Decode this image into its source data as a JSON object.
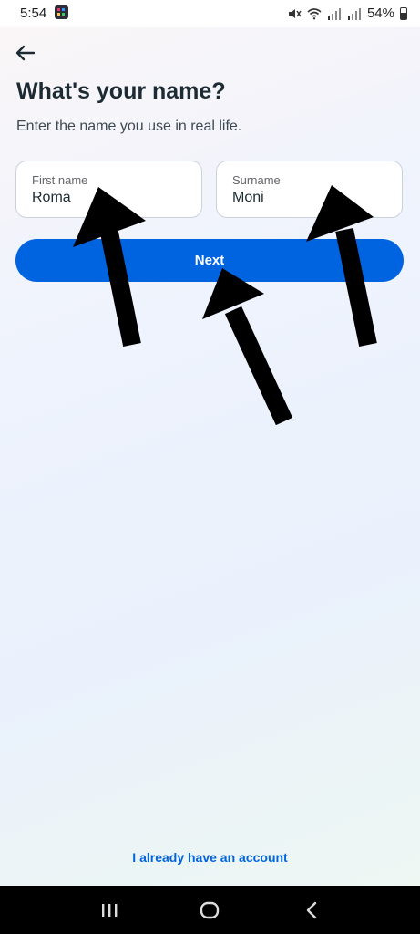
{
  "status_bar": {
    "time": "5:54",
    "battery": "54%",
    "icons": [
      "app-notification-icon",
      "mute-icon",
      "wifi-icon",
      "signal-icon",
      "signal-icon",
      "battery-icon"
    ]
  },
  "header": {
    "back_icon": "back-arrow-icon",
    "title": "What's your name?",
    "subtitle": "Enter the name you use in real life."
  },
  "form": {
    "first_name": {
      "label": "First name",
      "value": "Roma"
    },
    "surname": {
      "label": "Surname",
      "value": "Moni"
    },
    "next_label": "Next"
  },
  "footer": {
    "account_link": "I already have an account"
  },
  "nav_bar": {
    "icons": [
      "recent-apps-icon",
      "home-icon",
      "back-icon"
    ]
  },
  "colors": {
    "accent": "#0064e0",
    "title": "#1c2b33",
    "annotation_arrows": "#000000"
  }
}
